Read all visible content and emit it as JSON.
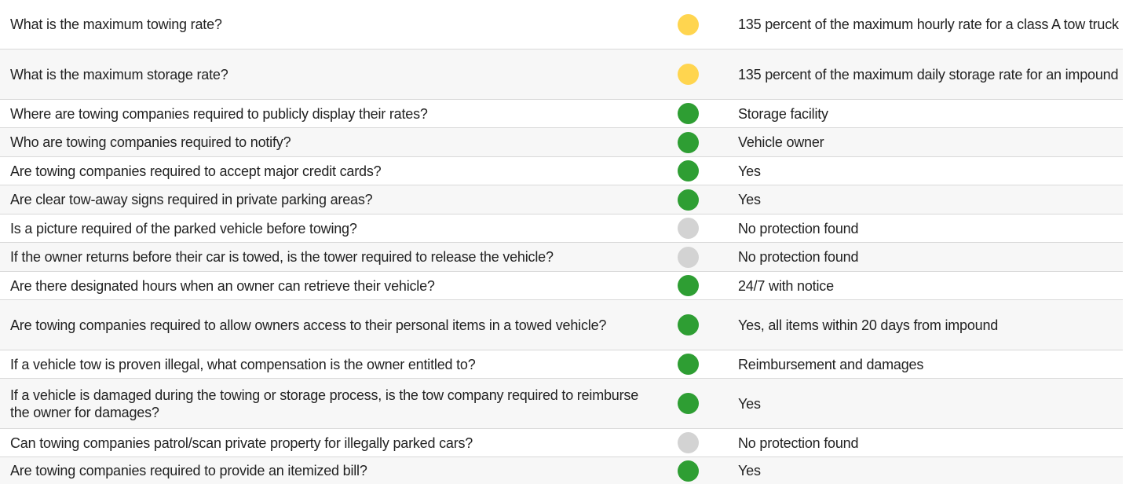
{
  "colors": {
    "yellow": "#FFD54F",
    "green": "#2E9E33",
    "gray": "#D3D3D3"
  },
  "rows": [
    {
      "question": "What is the maximum towing rate?",
      "status": "yellow",
      "answer": "135 percent of the maximum hourly rate for a class A tow truck"
    },
    {
      "question": "What is the maximum storage rate?",
      "status": "yellow",
      "answer": "135 percent of the maximum daily storage rate for an impound"
    },
    {
      "question": "Where are towing companies required to publicly display their rates?",
      "status": "green",
      "answer": "Storage facility"
    },
    {
      "question": "Who are towing companies required to notify?",
      "status": "green",
      "answer": "Vehicle owner"
    },
    {
      "question": "Are towing companies required to accept major credit cards?",
      "status": "green",
      "answer": "Yes"
    },
    {
      "question": "Are clear tow-away signs required in private parking areas?",
      "status": "green",
      "answer": "Yes"
    },
    {
      "question": "Is a picture required of the parked vehicle before towing?",
      "status": "gray",
      "answer": "No protection found"
    },
    {
      "question": "If the owner returns before their car is towed, is the tower required to release the vehicle?",
      "status": "gray",
      "answer": "No protection found"
    },
    {
      "question": "Are there designated hours when an owner can retrieve their vehicle?",
      "status": "green",
      "answer": "24/7 with notice"
    },
    {
      "question": "Are towing companies required to allow owners access to their personal items in a towed vehicle?",
      "status": "green",
      "answer": "Yes, all items within 20 days from impound"
    },
    {
      "question": "If a vehicle tow is proven illegal, what compensation is the owner entitled to?",
      "status": "green",
      "answer": "Reimbursement and damages"
    },
    {
      "question": "If a vehicle is damaged during the towing or storage process, is the tow company required to reimburse the owner for damages?",
      "status": "green",
      "answer": "Yes"
    },
    {
      "question": "Can towing companies patrol/scan private property for illegally parked cars?",
      "status": "gray",
      "answer": "No protection found"
    },
    {
      "question": "Are towing companies required to provide an itemized bill?",
      "status": "green",
      "answer": "Yes"
    }
  ]
}
